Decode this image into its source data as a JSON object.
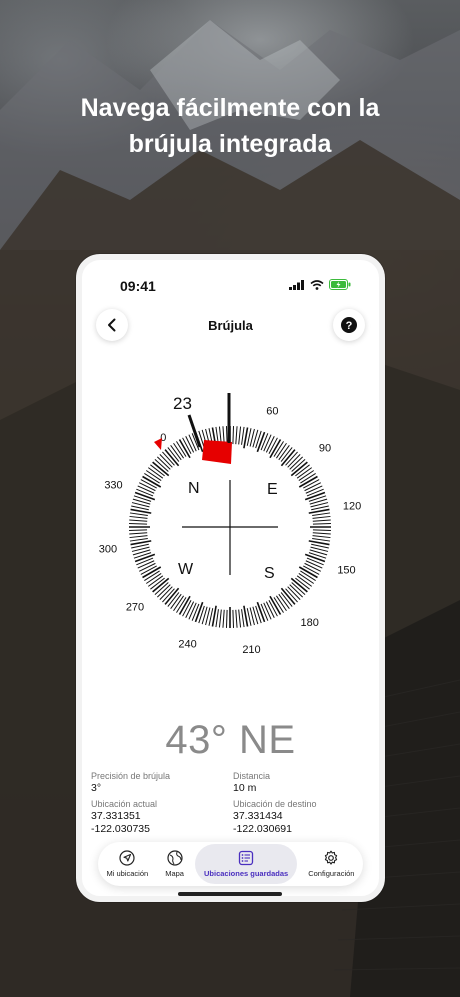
{
  "headline": {
    "line1": "Navega fácilmente con la",
    "line2": "brújula integrada"
  },
  "status_bar": {
    "time": "09:41"
  },
  "nav": {
    "title": "Brújula",
    "back_icon": "chevron-left-icon",
    "help_icon": "question-circle-icon"
  },
  "compass": {
    "pointer_value": "23",
    "heading_degrees": 43,
    "cardinals": [
      "N",
      "E",
      "S",
      "W"
    ],
    "degree_labels": [
      "0",
      "60",
      "90",
      "120",
      "150",
      "180",
      "210",
      "240",
      "270",
      "300",
      "330"
    ],
    "accent": "#e60000"
  },
  "heading_text": "43° NE",
  "info": {
    "precision_label": "Precisión de brújula",
    "precision_value": "3°",
    "distance_label": "Distancia",
    "distance_value": "10 m",
    "current_label": "Ubicación actual",
    "current_lat": "37.331351",
    "current_lon": "-122.030735",
    "dest_label": "Ubicación de destino",
    "dest_lat": "37.331434",
    "dest_lon": "-122.030691"
  },
  "tabs": [
    {
      "label": "Mi ubicación",
      "icon": "navigation-arrow-icon"
    },
    {
      "label": "Mapa",
      "icon": "globe-icon"
    },
    {
      "label": "Ubicaciones guardadas",
      "icon": "saved-list-icon",
      "active": true
    },
    {
      "label": "Configuración",
      "icon": "gear-icon"
    }
  ],
  "colors": {
    "active_tab": "#4a2fbf",
    "heading_gray": "#8a8a8a"
  }
}
